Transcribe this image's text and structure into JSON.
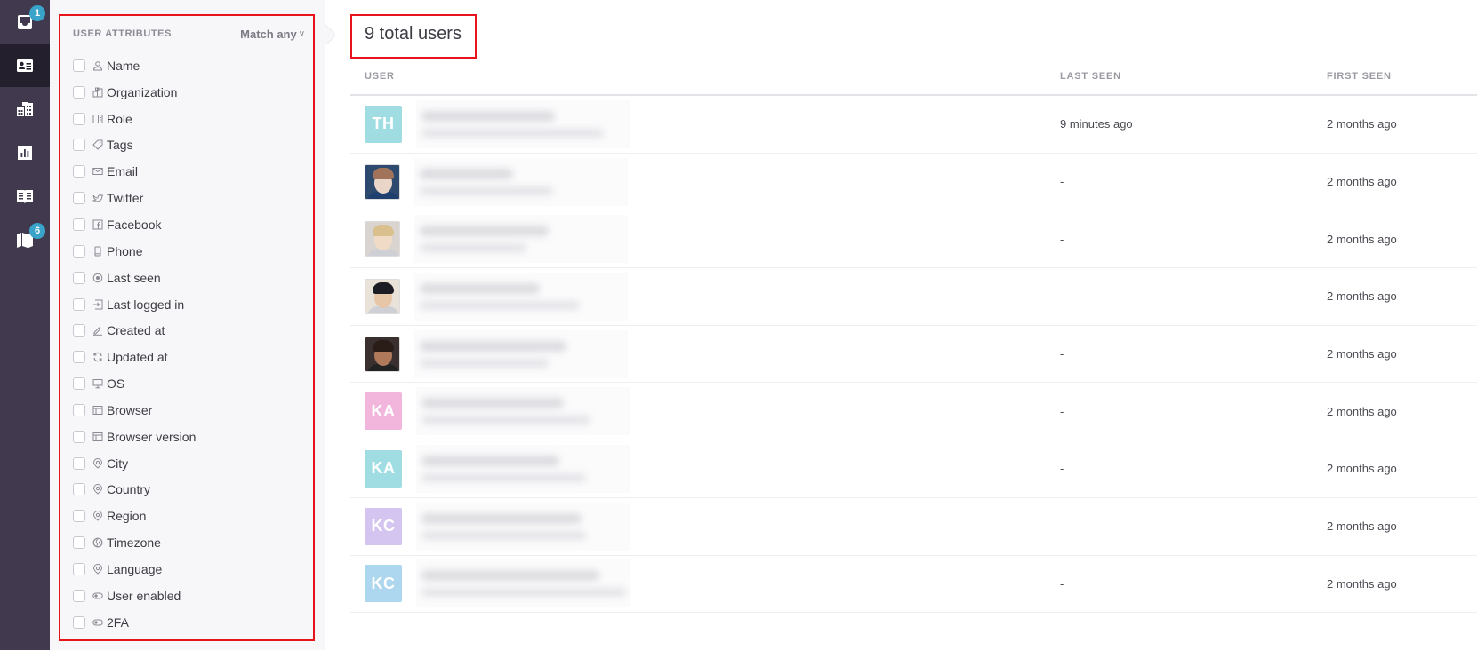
{
  "nav": {
    "items": [
      {
        "name": "inbox",
        "icon": "inbox-icon",
        "badge": "1",
        "active": false
      },
      {
        "name": "users",
        "icon": "contact-card-icon",
        "badge": null,
        "active": true
      },
      {
        "name": "companies",
        "icon": "buildings-icon",
        "badge": null,
        "active": false
      },
      {
        "name": "reports",
        "icon": "bar-chart-icon",
        "badge": null,
        "active": false
      },
      {
        "name": "knowledge-base",
        "icon": "open-book-icon",
        "badge": null,
        "active": false
      },
      {
        "name": "roadmap",
        "icon": "map-icon",
        "badge": "6",
        "active": false
      }
    ]
  },
  "filters": {
    "title": "USER ATTRIBUTES",
    "match_label": "Match any",
    "match_chevron": "˅",
    "attributes": [
      {
        "label": "Name",
        "icon": "person-icon",
        "checked": false
      },
      {
        "label": "Organization",
        "icon": "building-icon",
        "checked": false
      },
      {
        "label": "Role",
        "icon": "role-card-icon",
        "checked": false
      },
      {
        "label": "Tags",
        "icon": "tag-icon",
        "checked": false
      },
      {
        "label": "Email",
        "icon": "envelope-icon",
        "checked": false
      },
      {
        "label": "Twitter",
        "icon": "twitter-bird-icon",
        "checked": false
      },
      {
        "label": "Facebook",
        "icon": "facebook-icon",
        "checked": false
      },
      {
        "label": "Phone",
        "icon": "phone-icon",
        "checked": false
      },
      {
        "label": "Last seen",
        "icon": "target-icon",
        "checked": false
      },
      {
        "label": "Last logged in",
        "icon": "login-icon",
        "checked": false
      },
      {
        "label": "Created at",
        "icon": "pencil-icon",
        "checked": false
      },
      {
        "label": "Updated at",
        "icon": "refresh-icon",
        "checked": false
      },
      {
        "label": "OS",
        "icon": "monitor-icon",
        "checked": false
      },
      {
        "label": "Browser",
        "icon": "browser-window-icon",
        "checked": false
      },
      {
        "label": "Browser version",
        "icon": "browser-window-icon",
        "checked": false
      },
      {
        "label": "City",
        "icon": "location-pin-icon",
        "checked": false
      },
      {
        "label": "Country",
        "icon": "location-pin-icon",
        "checked": false
      },
      {
        "label": "Region",
        "icon": "location-pin-icon",
        "checked": false
      },
      {
        "label": "Timezone",
        "icon": "globe-clock-icon",
        "checked": false
      },
      {
        "label": "Language",
        "icon": "location-pin-icon",
        "checked": false
      },
      {
        "label": "User enabled",
        "icon": "toggle-icon",
        "checked": false
      },
      {
        "label": "2FA",
        "icon": "toggle-icon",
        "checked": false
      }
    ]
  },
  "main": {
    "total_label": "9 total users",
    "columns": {
      "user": "USER",
      "last_seen": "LAST SEEN",
      "first_seen": "FIRST SEEN"
    },
    "users": [
      {
        "avatar_type": "initials",
        "initials": "TH",
        "color": "#9fdde2",
        "last_seen": "9 minutes ago",
        "first_seen": "2 months ago",
        "name_redacted": true
      },
      {
        "avatar_type": "photo",
        "initials": "",
        "color": "#2d4a6e",
        "last_seen": "-",
        "first_seen": "2 months ago",
        "name_redacted": true
      },
      {
        "avatar_type": "photo",
        "initials": "",
        "color": "#d9d4cf",
        "last_seen": "-",
        "first_seen": "2 months ago",
        "name_redacted": true
      },
      {
        "avatar_type": "photo",
        "initials": "",
        "color": "#e8e2d8",
        "last_seen": "-",
        "first_seen": "2 months ago",
        "name_redacted": true
      },
      {
        "avatar_type": "photo",
        "initials": "",
        "color": "#3a3030",
        "last_seen": "-",
        "first_seen": "2 months ago",
        "name_redacted": true
      },
      {
        "avatar_type": "initials",
        "initials": "KA",
        "color": "#f2b6dc",
        "last_seen": "-",
        "first_seen": "2 months ago",
        "name_redacted": true
      },
      {
        "avatar_type": "initials",
        "initials": "KA",
        "color": "#9fdde2",
        "last_seen": "-",
        "first_seen": "2 months ago",
        "name_redacted": true
      },
      {
        "avatar_type": "initials",
        "initials": "KC",
        "color": "#d3c4f0",
        "last_seen": "-",
        "first_seen": "2 months ago",
        "name_redacted": true
      },
      {
        "avatar_type": "initials",
        "initials": "KC",
        "color": "#acd7ee",
        "last_seen": "-",
        "first_seen": "2 months ago",
        "name_redacted": true
      }
    ]
  },
  "colors": {
    "nav_bg": "#413a4f",
    "nav_active_bg": "#241f2c",
    "badge": "#3aa3c9",
    "highlight_border": "#e8141b"
  }
}
